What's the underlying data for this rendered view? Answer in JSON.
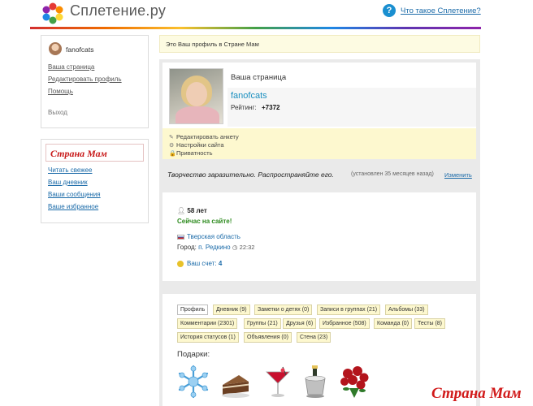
{
  "header": {
    "site_name": "Сплетение.ру",
    "help_icon": "?",
    "help_link": "Что такое Сплетение?"
  },
  "user_menu": {
    "username": "fanofcats",
    "links": [
      "Ваша страница",
      "Редактировать профиль",
      "Помощь"
    ],
    "logout": "Выход"
  },
  "strana_mam": {
    "title": "Страна Мам",
    "links": [
      "Читать свежее",
      "Ваш дневник",
      "Ваши сообщения",
      "Ваше избранное"
    ]
  },
  "profile": {
    "notice": "Это Ваш профиль в Стране Мам",
    "page_label": "Ваша страница",
    "name": "fanofcats",
    "rating_label": "Рейтинг:",
    "rating_value": "+7372",
    "actions": [
      {
        "icon": "pencil-icon",
        "glyph": "✎",
        "label": "Редактировать анкету"
      },
      {
        "icon": "gear-icon",
        "glyph": "⚙",
        "label": "Настройки сайта"
      },
      {
        "icon": "lock-icon",
        "glyph": "🔒",
        "label": "Приватность"
      }
    ],
    "status_text": "Творчество заразительно. Распространяйте его.",
    "status_meta": "(установлен 35 месяцев назад)",
    "status_change": "Изменить"
  },
  "info": {
    "age": "58 лет",
    "online": "Сейчас на сайте!",
    "region": "Тверская область",
    "city_label": "Город:",
    "city_value": "п. Редкино",
    "city_time": "22:32",
    "score_label": "Ваш счет:",
    "score_value": "4"
  },
  "tabs": {
    "row1": [
      "Профиль",
      "Дневник (9)",
      "Заметки о детях (0)",
      "Записи в группах (21)",
      "Альбомы (33)"
    ],
    "row2": [
      "Комментарии (2301)",
      "Группы (21)",
      "Друзья (6)",
      "Избранное (508)",
      "Команда (0)",
      "Тесты (8)"
    ],
    "row3": [
      "История статусов (1)",
      "Объявления (0)",
      "Стена (23)"
    ],
    "active": "Профиль"
  },
  "gifts": {
    "title": "Подарки:",
    "items": [
      "snowflake-gift-icon",
      "cake-gift-icon",
      "cocktail-gift-icon",
      "champagne-bucket-gift-icon",
      "roses-gift-icon"
    ]
  },
  "watermark": "Страна Мам",
  "colors": {
    "link": "#1a6aa8",
    "online": "#2e8b1f",
    "highlight": "#fdf8cf",
    "brand_red": "#c81a1a"
  }
}
